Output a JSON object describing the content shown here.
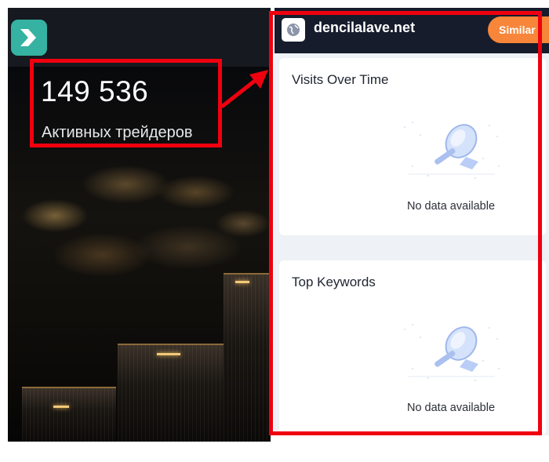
{
  "left": {
    "stat_number": "149 536",
    "stat_label": "Активных трейдеров",
    "logo_icon": "broker-logo-icon"
  },
  "right": {
    "site_domain": "dencilalave.net",
    "similar_button": "Similar",
    "site_icon": "globe-icon",
    "cards": [
      {
        "title": "Visits Over Time",
        "empty_text": "No data available"
      },
      {
        "title": "Top Keywords",
        "empty_text": "No data available"
      }
    ]
  },
  "colors": {
    "annotation_red": "#f0000f",
    "accent_orange": "#f7863a",
    "logo_teal": "#35b2a1",
    "header_navy": "#161c2c"
  }
}
